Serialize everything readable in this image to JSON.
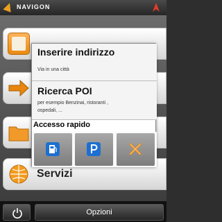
{
  "app": {
    "brand": "NAVIGON"
  },
  "main_menu": {
    "services_label": "Servizi"
  },
  "popup": {
    "items": [
      {
        "title": "Inserire indirizzo",
        "subtitle": "Via in una città"
      },
      {
        "title": "Ricerca POI",
        "subtitle_line1": "per esempio Benzinai, ristoranti ,",
        "subtitle_line2": "ospedali, ..."
      }
    ],
    "quick_access_label": "Accesso rapido",
    "quick_access_icons": [
      "fuel-pump-icon",
      "parking-icon",
      "restaurant-icon"
    ]
  },
  "bottom_bar": {
    "options_label": "Opzioni"
  },
  "colors": {
    "accent_orange": "#e98a10",
    "quick_blue": "#1d6fd1"
  }
}
